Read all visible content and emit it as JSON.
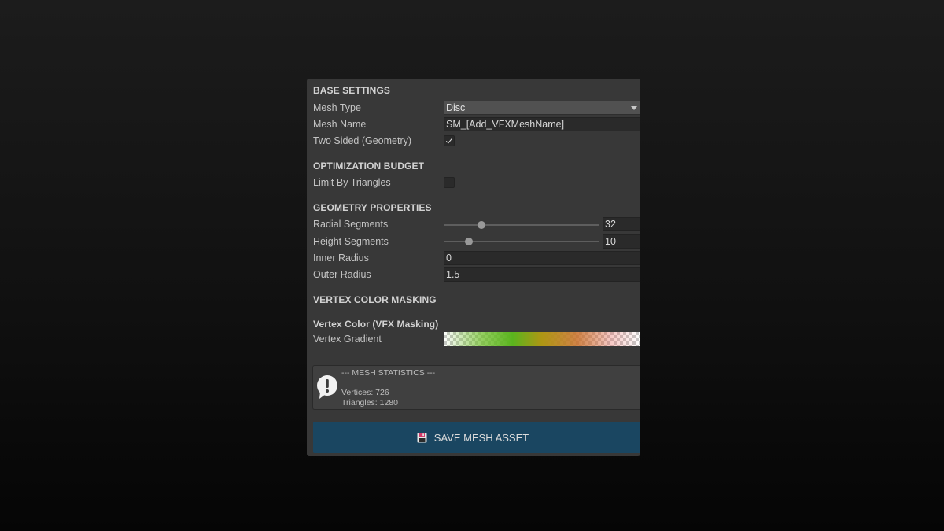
{
  "sections": {
    "base_settings": "BASE SETTINGS",
    "optimization_budget": "OPTIMIZATION BUDGET",
    "geometry_properties": "GEOMETRY PROPERTIES",
    "vertex_color_masking": "VERTEX COLOR MASKING"
  },
  "base": {
    "mesh_type_label": "Mesh Type",
    "mesh_type_value": "Disc",
    "mesh_name_label": "Mesh Name",
    "mesh_name_value": "SM_[Add_VFXMeshName]",
    "two_sided_label": "Two Sided (Geometry)",
    "two_sided_checked": true
  },
  "budget": {
    "limit_by_triangles_label": "Limit By Triangles",
    "limit_by_triangles_checked": false
  },
  "geometry": {
    "radial_segments_label": "Radial Segments",
    "radial_segments_value": "32",
    "radial_segments_fraction": 0.24,
    "height_segments_label": "Height Segments",
    "height_segments_value": "10",
    "height_segments_fraction": 0.16,
    "inner_radius_label": "Inner Radius",
    "inner_radius_value": "0",
    "outer_radius_label": "Outer Radius",
    "outer_radius_value": "1.5"
  },
  "vertex_color": {
    "subheader": "Vertex Color (VFX Masking)",
    "gradient_label": "Vertex Gradient"
  },
  "stats": {
    "title": "--- MESH STATISTICS ---",
    "vertices": "Vertices: 726",
    "triangles": "Triangles: 1280",
    "icon": "info-exclamation-icon"
  },
  "save_button": {
    "label": "SAVE MESH ASSET",
    "icon": "floppy-disk-icon"
  },
  "colors": {
    "panel_bg": "#383838",
    "button_bg": "#1a4661",
    "field_bg": "#2a2a2a"
  }
}
